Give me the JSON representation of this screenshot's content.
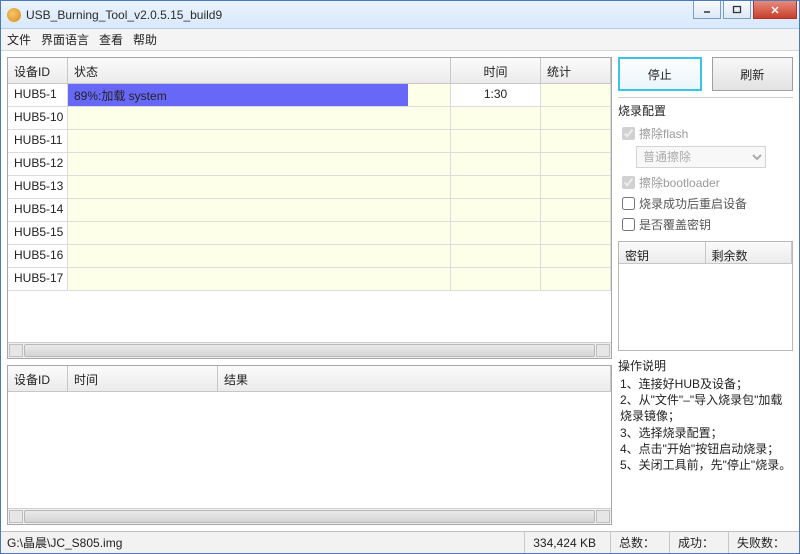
{
  "window": {
    "title": "USB_Burning_Tool_v2.0.5.15_build9"
  },
  "menu": {
    "file": "文件",
    "lang": "界面语言",
    "view": "查看",
    "help": "帮助"
  },
  "grid1": {
    "headers": {
      "id": "设备ID",
      "status": "状态",
      "time": "时间",
      "stat": "统计"
    },
    "rows": [
      {
        "id": "HUB5-1",
        "status": "89%:加载 system",
        "time": "1:30",
        "stat": ""
      },
      {
        "id": "HUB5-10",
        "status": "",
        "time": "",
        "stat": ""
      },
      {
        "id": "HUB5-11",
        "status": "",
        "time": "",
        "stat": ""
      },
      {
        "id": "HUB5-12",
        "status": "",
        "time": "",
        "stat": ""
      },
      {
        "id": "HUB5-13",
        "status": "",
        "time": "",
        "stat": ""
      },
      {
        "id": "HUB5-14",
        "status": "",
        "time": "",
        "stat": ""
      },
      {
        "id": "HUB5-15",
        "status": "",
        "time": "",
        "stat": ""
      },
      {
        "id": "HUB5-16",
        "status": "",
        "time": "",
        "stat": ""
      },
      {
        "id": "HUB5-17",
        "status": "",
        "time": "",
        "stat": ""
      }
    ]
  },
  "grid2": {
    "headers": {
      "id": "设备ID",
      "time": "时间",
      "result": "结果"
    }
  },
  "buttons": {
    "stop": "停止",
    "refresh": "刷新"
  },
  "config": {
    "title": "烧录配置",
    "erase_flash": "擦除flash",
    "erase_mode": "普通擦除",
    "erase_bootloader": "擦除bootloader",
    "reboot": "烧录成功后重启设备",
    "overwrite_key": "是否覆盖密钥"
  },
  "key": {
    "col1": "密钥",
    "col2": "剩余数"
  },
  "instructions": {
    "title": "操作说明",
    "l1": "1、连接好HUB及设备；",
    "l2": "2、从\"文件\"–\"导入烧录包\"加载烧录镜像；",
    "l3": "3、选择烧录配置；",
    "l4": "4、点击\"开始\"按钮启动烧录；",
    "l5": "5、关闭工具前，先\"停止\"烧录。"
  },
  "status": {
    "path": "G:\\晶晨\\JC_S805.img",
    "size": "334,424 KB",
    "total_lbl": "总数：",
    "success_lbl": "成功：",
    "fail_lbl": "失败数："
  }
}
